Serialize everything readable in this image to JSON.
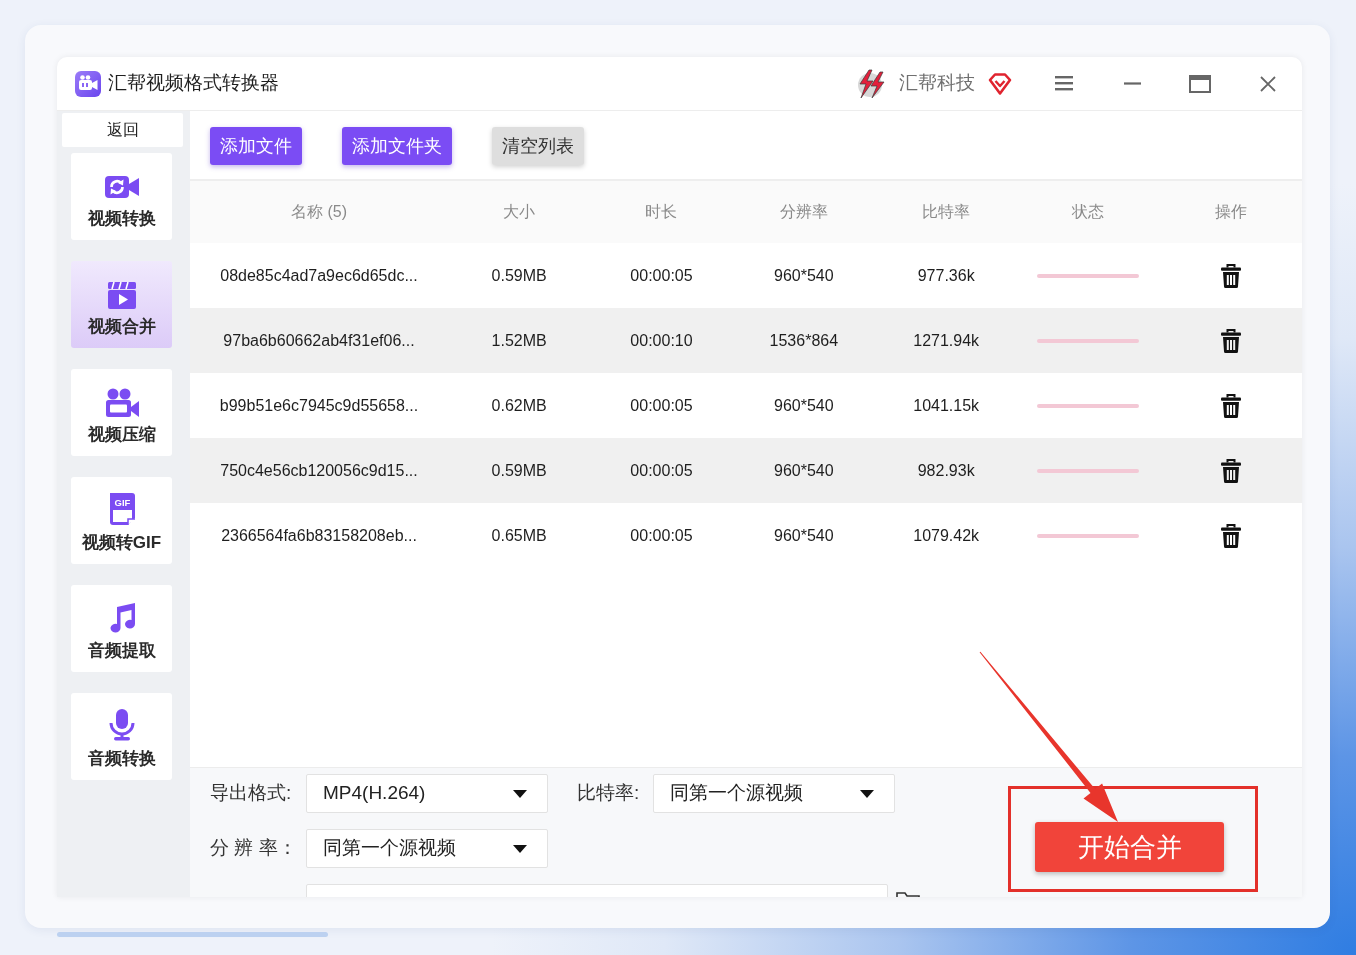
{
  "window": {
    "title": "汇帮视频格式转换器",
    "brand": "汇帮科技"
  },
  "sidebar": {
    "back": "返回",
    "items": [
      {
        "label": "视频转换",
        "selected": false
      },
      {
        "label": "视频合并",
        "selected": true
      },
      {
        "label": "视频压缩",
        "selected": false
      },
      {
        "label": "视频转GIF",
        "icon_text": "GIF",
        "selected": false
      },
      {
        "label": "音频提取",
        "selected": false
      },
      {
        "label": "音频转换",
        "selected": false
      }
    ]
  },
  "toolbar": {
    "buttons": [
      {
        "label": "添加文件",
        "kind": "primary"
      },
      {
        "label": "添加文件夹",
        "kind": "primary"
      },
      {
        "label": "清空列表",
        "kind": "secondary"
      }
    ]
  },
  "table": {
    "columns": [
      "名称 (5)",
      "大小",
      "时长",
      "分辨率",
      "比特率",
      "状态",
      "操作"
    ],
    "rows": [
      {
        "name": "08de85c4ad7a9ec6d65dc...",
        "size": "0.59MB",
        "duration": "00:00:05",
        "resolution": "960*540",
        "bitrate": "977.36k",
        "level": 0
      },
      {
        "name": "97ba6b60662ab4f31ef06...",
        "size": "1.52MB",
        "duration": "00:00:10",
        "resolution": "1536*864",
        "bitrate": "1271.94k",
        "level": 0
      },
      {
        "name": "b99b51e6c7945c9d55658...",
        "size": "0.62MB",
        "duration": "00:00:05",
        "resolution": "960*540",
        "bitrate": "1041.15k",
        "level": 0
      },
      {
        "name": "750c4e56cb120056c9d15...",
        "size": "0.59MB",
        "duration": "00:00:05",
        "resolution": "960*540",
        "bitrate": "982.93k",
        "level": 0
      },
      {
        "name": "2366564fa6b83158208eb...",
        "size": "0.65MB",
        "duration": "00:00:05",
        "resolution": "960*540",
        "bitrate": "1079.42k",
        "level": 0
      }
    ]
  },
  "settings": {
    "rows": [
      [
        {
          "label": "导出格式:",
          "value": "MP4(H.264)"
        },
        {
          "label": "比特率:",
          "value": "同第一个源视频"
        }
      ],
      [
        {
          "label": "分 辨 率：",
          "value": "同第一个源视频"
        }
      ]
    ]
  },
  "action": {
    "label": "开始合并"
  }
}
